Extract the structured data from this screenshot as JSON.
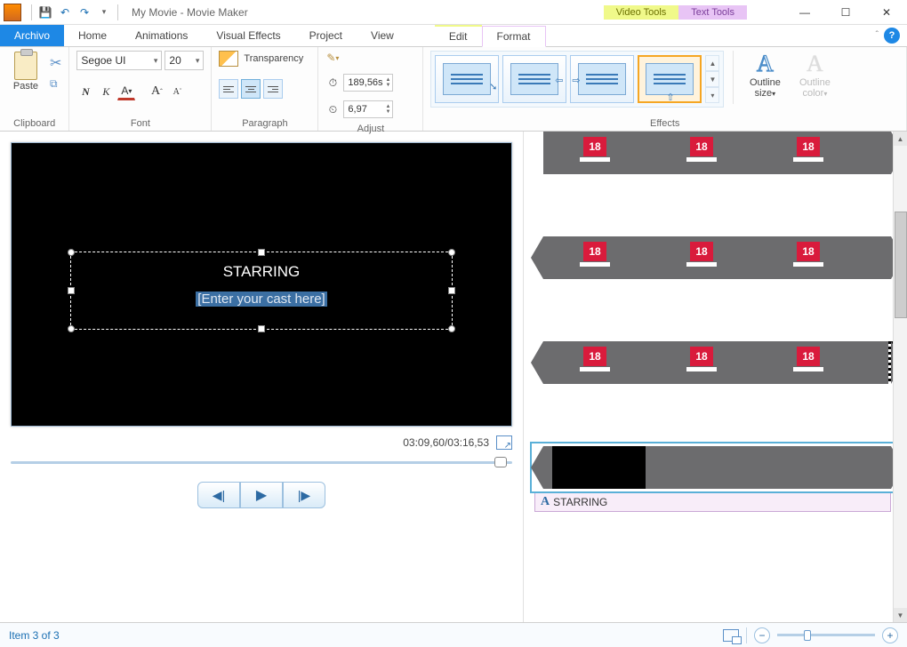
{
  "title": "My Movie - Movie Maker",
  "tool_tabs": {
    "video": "Video Tools",
    "text": "Text Tools"
  },
  "tabs": {
    "file": "Archivo",
    "home": "Home",
    "animations": "Animations",
    "visual_effects": "Visual Effects",
    "project": "Project",
    "view": "View",
    "edit": "Edit",
    "format": "Format"
  },
  "ribbon": {
    "clipboard": {
      "label": "Clipboard",
      "paste": "Paste"
    },
    "font": {
      "label": "Font",
      "family": "Segoe UI",
      "size": "20",
      "bold": "N",
      "italic": "K",
      "color_btn": "A",
      "grow": "A",
      "shrink": "A"
    },
    "paragraph": {
      "label": "Paragraph",
      "transparency": "Transparency"
    },
    "adjust": {
      "label": "Adjust",
      "start": "189,56s",
      "duration": "6,97"
    },
    "effects": {
      "label": "Effects"
    },
    "outline_size": "Outline size",
    "outline_color": "Outline color"
  },
  "preview": {
    "overlay_title": "STARRING",
    "overlay_placeholder": "[Enter your cast here]",
    "time": "03:09,60/03:16,53"
  },
  "timeline": {
    "badge": "18",
    "caption_label": "STARRING"
  },
  "status": {
    "item": "Item 3 of 3"
  }
}
